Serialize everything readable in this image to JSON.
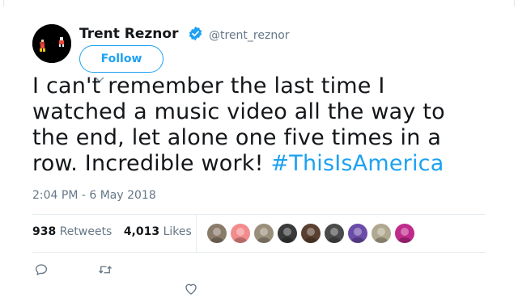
{
  "author": {
    "name": "Trent Reznor",
    "handle": "@trent_reznor",
    "verified": true,
    "avatar_icon": "profile-avatar"
  },
  "follow_label": "Follow",
  "tweet": {
    "text": "I can't remember the last time I watched a music video all the way to the end, let alone one five times in a row.  Incredible work! ",
    "hashtag": "#ThisIsAmerica"
  },
  "timestamp": "2:04 PM - 6 May 2018",
  "stats": {
    "retweets_count": "938",
    "retweets_label": "Retweets",
    "likes_count": "4,013",
    "likes_label": "Likes"
  },
  "likers": [
    {
      "name": "liker-avatar-1",
      "color": "#8a7a6a"
    },
    {
      "name": "liker-avatar-2",
      "color": "#f28c8c"
    },
    {
      "name": "liker-avatar-3",
      "color": "#9a8f7a"
    },
    {
      "name": "liker-avatar-4",
      "color": "#3b3a3a"
    },
    {
      "name": "liker-avatar-5",
      "color": "#5a4030"
    },
    {
      "name": "liker-avatar-6",
      "color": "#4a4a4a"
    },
    {
      "name": "liker-avatar-7",
      "color": "#6b4ca8"
    },
    {
      "name": "liker-avatar-8",
      "color": "#b0a890"
    },
    {
      "name": "liker-avatar-9",
      "color": "#c02a8a"
    }
  ],
  "actions": [
    {
      "name": "reply-icon"
    },
    {
      "name": "retweet-icon"
    },
    {
      "name": "like-icon"
    }
  ],
  "colors": {
    "accent": "#1da1f2",
    "text": "#14171a",
    "muted": "#657786",
    "divider": "#e6ecf0"
  }
}
